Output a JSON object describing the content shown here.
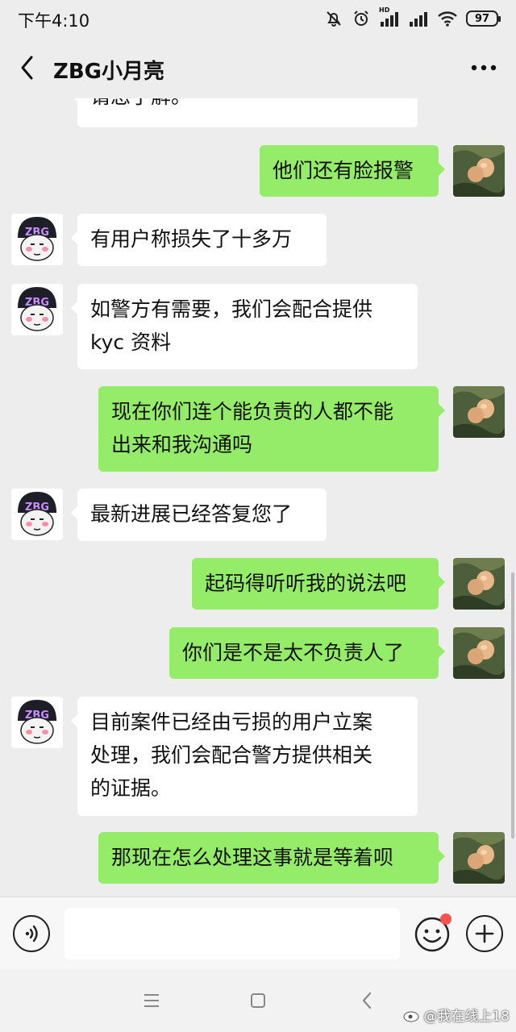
{
  "status_bar": {
    "time": "下午4:10",
    "battery": "97",
    "network_label": "HD",
    "icons": [
      "mute-icon",
      "alarm-icon",
      "signal-icon",
      "signal-icon",
      "wifi-icon",
      "battery-icon"
    ]
  },
  "header": {
    "title": "ZBG小月亮",
    "back_icon": "chevron-left-icon",
    "more_icon": "more-horizontal-icon"
  },
  "messages": [
    {
      "side": "left",
      "text": "请您了解。",
      "partial": true
    },
    {
      "side": "right",
      "text": "他们还有脸报警"
    },
    {
      "side": "left",
      "text": "有用户称损失了十多万"
    },
    {
      "side": "left",
      "text": "如警方有需要，我们会配合提供\nkyc 资料"
    },
    {
      "side": "right",
      "text": "现在你们连个能负责的人都不能\n出来和我沟通吗"
    },
    {
      "side": "left",
      "text": "最新进展已经答复您了"
    },
    {
      "side": "right",
      "text": "起码得听听我的说法吧"
    },
    {
      "side": "right",
      "text": "你们是不是太不负责人了"
    },
    {
      "side": "left",
      "text": "目前案件已经由亏损的用户立案\n处理，我们会配合警方提供相关\n的证据。"
    },
    {
      "side": "right",
      "text": "那现在怎么处理这事就是等着呗"
    }
  ],
  "avatars": {
    "left_text": "ZBG",
    "left_description": "cartoon-face-avatar-icon",
    "right_description": "fruit-photo-avatar-icon"
  },
  "input_bar": {
    "voice_icon": "voice-icon",
    "text_value": "",
    "emoji_icon": "emoji-icon",
    "plus_icon": "plus-icon"
  },
  "system_nav": {
    "menu_icon": "menu-icon",
    "home_icon": "square-icon",
    "back_icon": "back-triangle-icon"
  },
  "watermark": {
    "text": "@我在线上18"
  },
  "colors": {
    "background": "#ededed",
    "bubble_sent": "#95ec69",
    "bubble_received": "#ffffff",
    "red_dot": "#fa5151"
  }
}
